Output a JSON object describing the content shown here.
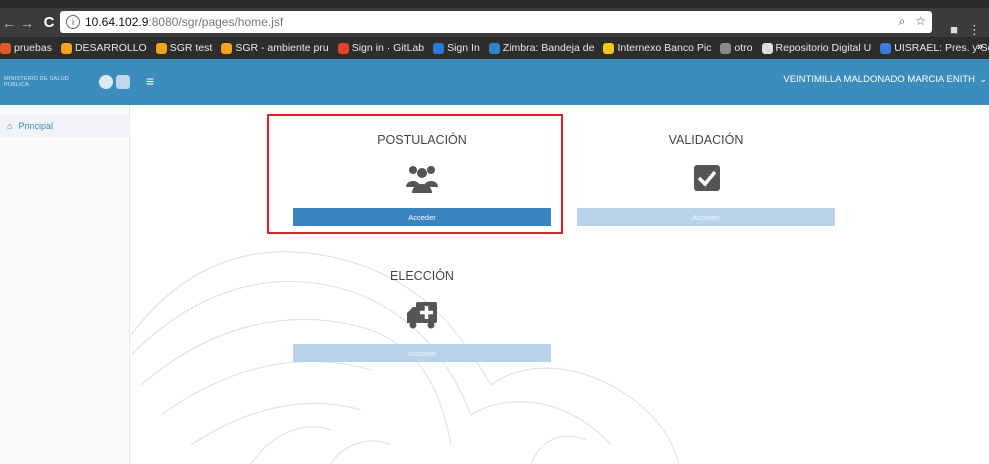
{
  "browser": {
    "url_host": "10.64.102.9",
    "url_path": ":8080/sgr/pages/home.jsf",
    "bookmarks": [
      {
        "label": "pruebas",
        "color": "#e0592b"
      },
      {
        "label": "DESARROLLO",
        "color": "#f2a41c"
      },
      {
        "label": "SGR test",
        "color": "#f2a41c"
      },
      {
        "label": "SGR - ambiente pru",
        "color": "#f2a41c"
      },
      {
        "label": "Sign in · GitLab",
        "color": "#e24329"
      },
      {
        "label": "Sign In",
        "color": "#2b7bd6"
      },
      {
        "label": "Zimbra: Bandeja de",
        "color": "#2e86c9"
      },
      {
        "label": "Internexo Banco Pic",
        "color": "#f5c518"
      },
      {
        "label": "otro",
        "color": "#888888"
      },
      {
        "label": "Repositorio Digital U",
        "color": "#dddddd"
      },
      {
        "label": "UISRAEL: Pres. y Se",
        "color": "#3b7dd8"
      }
    ]
  },
  "header": {
    "logo_text": "MINISTERIO DE SALUD PÚBLICA",
    "menu_icon": "hamburger-icon",
    "user_name": "VEINTIMILLA MALDONADO MARCIA ENITH"
  },
  "sidebar": {
    "items": [
      {
        "label": "Principal",
        "icon": "home-icon"
      }
    ]
  },
  "cards": [
    {
      "id": "postulacion",
      "title": "POSTULACIÓN",
      "icon": "users-icon",
      "button": "Acceder",
      "enabled": true
    },
    {
      "id": "validacion",
      "title": "VALIDACIÓN",
      "icon": "checkbox-icon",
      "button": "Acceder",
      "enabled": false
    },
    {
      "id": "eleccion",
      "title": "ELECCIÓN",
      "icon": "ambulance-icon",
      "button": "Acceder",
      "enabled": false
    }
  ],
  "colors": {
    "header": "#3c8dbc",
    "button_active": "#3a84bf",
    "button_disabled": "#b9d4ea",
    "highlight": "#d9232c"
  }
}
